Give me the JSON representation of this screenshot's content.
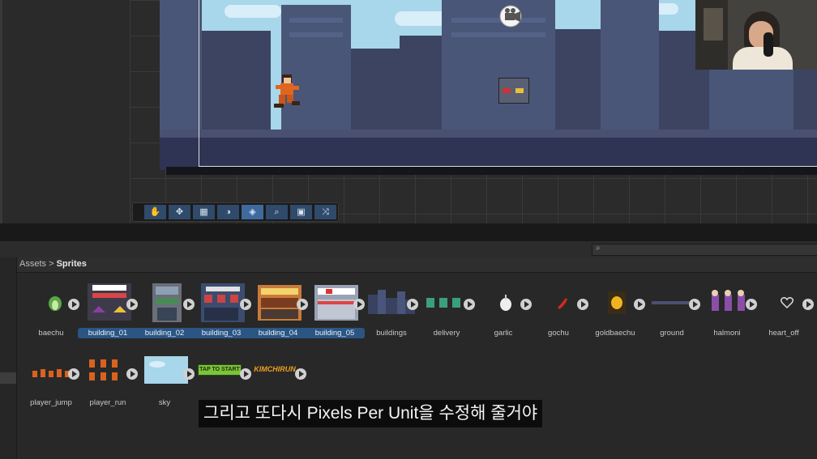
{
  "breadcrumb": {
    "root": "Assets",
    "separator": ">",
    "current": "Sprites"
  },
  "search": {
    "placeholder": ""
  },
  "toolbar": {
    "tools": [
      {
        "name": "hand-tool-icon",
        "glyph": "✋"
      },
      {
        "name": "move-tool-icon",
        "glyph": "✥"
      },
      {
        "name": "grid-tool-icon",
        "glyph": "▦"
      },
      {
        "name": "shading-tool-icon",
        "glyph": "◑"
      },
      {
        "name": "layers-tool-icon",
        "glyph": "◈"
      },
      {
        "name": "search-tool-icon",
        "glyph": "⌕"
      },
      {
        "name": "camera-tool-icon",
        "glyph": "▣"
      },
      {
        "name": "shuffle-tool-icon",
        "glyph": "⤨"
      }
    ]
  },
  "assets_row1": [
    {
      "label": "baechu"
    },
    {
      "label": "building_01"
    },
    {
      "label": "building_02"
    },
    {
      "label": "building_03"
    },
    {
      "label": "building_04"
    },
    {
      "label": "building_05"
    },
    {
      "label": "buildings"
    },
    {
      "label": "delivery"
    },
    {
      "label": "garlic"
    },
    {
      "label": "gochu"
    },
    {
      "label": "goldbaechu"
    },
    {
      "label": "ground"
    },
    {
      "label": "halmoni"
    },
    {
      "label": "heart_off"
    }
  ],
  "assets_row2": [
    {
      "label": "player_jump"
    },
    {
      "label": "player_run"
    },
    {
      "label": "sky"
    },
    {
      "label": "TAP TO START"
    },
    {
      "label": "KIMCHIRUN"
    }
  ],
  "subtitle": "그리고 또다시 Pixels Per Unit을 수정해 줄거야",
  "colors": {
    "selection": "#2b5583",
    "panel": "#282828",
    "sky": "#a8d6ea"
  }
}
